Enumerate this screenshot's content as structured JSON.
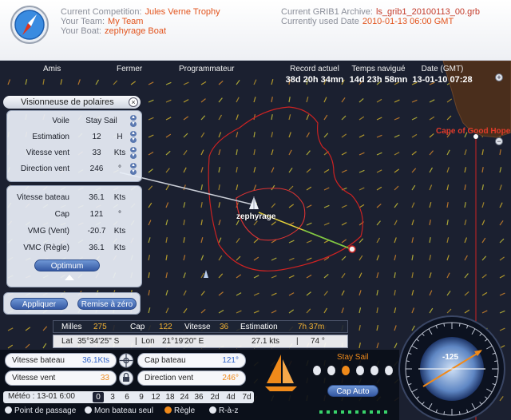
{
  "header": {
    "competition_label": "Current Competition:",
    "competition": "Jules Verne Trophy",
    "team_label": "Your Team:",
    "team": "My Team",
    "boat_label": "Your Boat:",
    "boat": "zephyrage Boat",
    "grib_label": "Current GRIB1 Archive:",
    "grib": "ls_grib1_20100113_00.grb",
    "used_date_label": "Currently used Date",
    "used_date": "2010-01-13 06:00 GMT"
  },
  "toolbar": {
    "amis": "Amis",
    "fermer": "Fermer",
    "programmateur": "Programmateur"
  },
  "stats": {
    "record_label": "Record actuel",
    "record_value": "38d 20h 34mn",
    "sailed_label": "Temps navigué",
    "sailed_value": "14d 23h 58mn",
    "date_label": "Date (GMT)",
    "date_value": "13-01-10 07:28"
  },
  "map": {
    "cape_label": "Cape of Good Hope",
    "boat_name": "zephyrage",
    "colors": {
      "isochrone": "#cc2222",
      "route": "#f0d030",
      "land": "#4a2e1c"
    }
  },
  "polar": {
    "title": "Visionneuse de polaires",
    "close_icon": "close-icon",
    "inputs": [
      {
        "label": "Voile",
        "value": "Stay Sail",
        "unit": ""
      },
      {
        "label": "Estimation",
        "value": "12",
        "unit": "H"
      },
      {
        "label": "Vitesse vent",
        "value": "33",
        "unit": "Kts"
      },
      {
        "label": "Direction vent",
        "value": "246",
        "unit": "°"
      }
    ],
    "results": [
      {
        "label": "Vitesse bateau",
        "value": "36.1",
        "unit": "Kts"
      },
      {
        "label": "Cap",
        "value": "121",
        "unit": "°"
      },
      {
        "label": "VMG (Vent)",
        "value": "-20.7",
        "unit": "Kts"
      },
      {
        "label": "VMC (Règle)",
        "value": "36.1",
        "unit": "Kts"
      }
    ],
    "optimum": "Optimum",
    "apply": "Appliquer",
    "reset": "Remise à zéro"
  },
  "info": {
    "milles_label": "Milles",
    "milles": "275",
    "cap_label": "Cap",
    "cap": "122",
    "vitesse_label": "Vitesse",
    "vitesse": "36",
    "estimation_label": "Estimation",
    "estimation": "7h 37m",
    "lat_label": "Lat",
    "lat": "35°34'25\" S",
    "lon_label": "Lon",
    "lon": "21°19'20\" E",
    "speed": "27.1 kts",
    "heading": "74 °"
  },
  "dashboard": {
    "boat_speed_label": "Vitesse bateau",
    "boat_speed": "36.1Kts",
    "heading_label": "Cap bateau",
    "heading": "121°",
    "wind_speed_label": "Vitesse vent",
    "wind_speed": "33",
    "wind_dir_label": "Direction vent",
    "wind_dir": "246°",
    "sail": "Stay Sail",
    "cap_auto": "Cap Auto",
    "dial_value": "-125"
  },
  "meteo": {
    "label": "Météo : 13-01 6:00",
    "steps": [
      "0",
      "3",
      "6",
      "9",
      "12",
      "18",
      "24",
      "36",
      "2d",
      "4d",
      "7d"
    ],
    "selected": "0"
  },
  "legend": {
    "waypoint": "Point de passage",
    "my_boat_only": "Mon bateau seul",
    "rule": "Règle",
    "reset": "R-à-z"
  }
}
